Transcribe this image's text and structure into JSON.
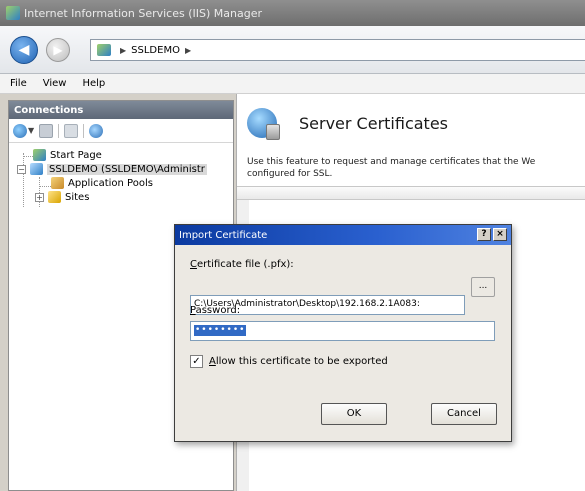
{
  "window": {
    "title": "Internet Information Services (IIS) Manager"
  },
  "address": {
    "back_icon": "back-arrow-icon",
    "forward_icon": "forward-arrow-icon",
    "path": [
      "SSLDEMO"
    ]
  },
  "menu": {
    "items": [
      "File",
      "View",
      "Help"
    ]
  },
  "connections": {
    "header": "Connections",
    "tree": {
      "start_page": "Start Page",
      "server": "SSLDEMO (SSLDEMO\\Administr",
      "app_pools": "Application Pools",
      "sites": "Sites",
      "sites_expander": "+",
      "server_expander": "−"
    }
  },
  "content": {
    "title": "Server Certificates",
    "description_line1": "Use this feature to request and manage certificates that the We",
    "description_line2": "configured for SSL."
  },
  "dialog": {
    "title": "Import Certificate",
    "help_label": "?",
    "close_label": "×",
    "file_label_accel": "C",
    "file_label_rest": "ertificate file (.pfx):",
    "file_value": "C:\\Users\\Administrator\\Desktop\\192.168.2.1A083:",
    "browse_label": "...",
    "password_label_accel": "P",
    "password_label_rest": "assword:",
    "password_value": "••••••••",
    "checkbox_checked": "✓",
    "checkbox_accel": "A",
    "checkbox_rest": "llow this certificate to be exported",
    "ok_label": "OK",
    "cancel_label": "Cancel"
  }
}
